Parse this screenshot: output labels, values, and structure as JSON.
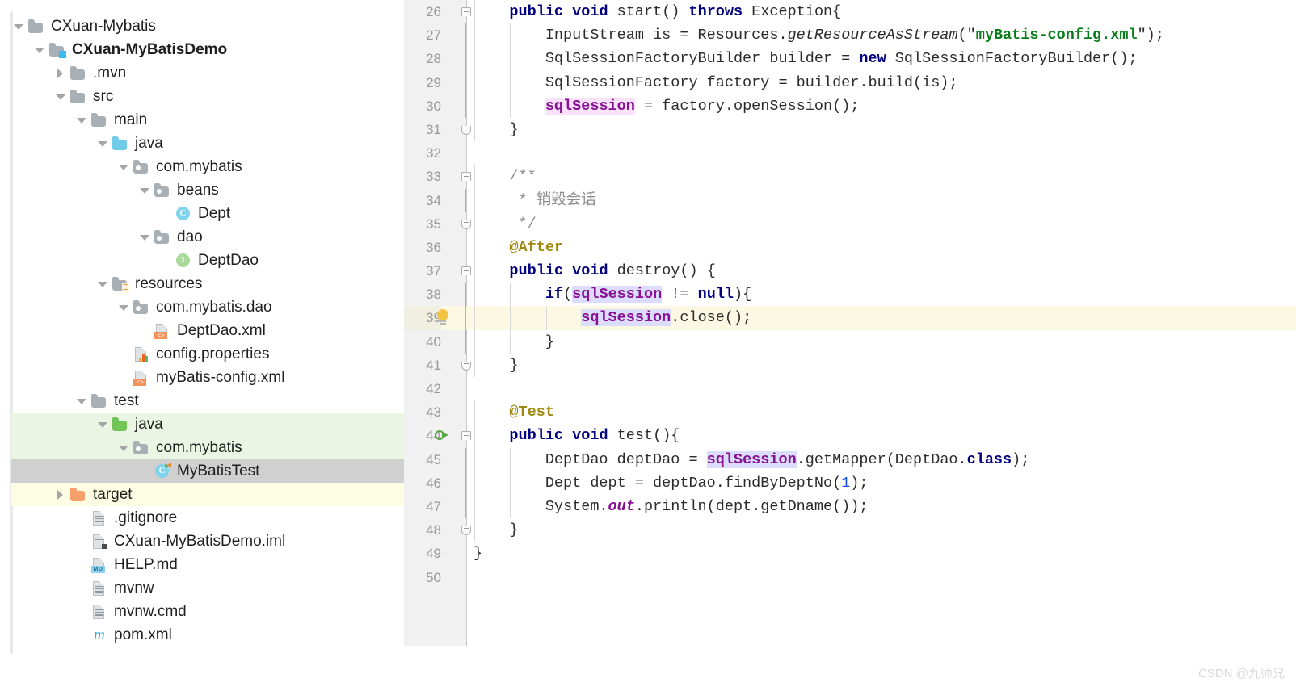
{
  "project_tree": {
    "scrollbar": "vertical-scrollbar",
    "items": [
      {
        "label": "CXuan-Mybatis",
        "depth": 0,
        "twisty": "down",
        "icon": "folder",
        "bold": false,
        "highlight": "none"
      },
      {
        "label": "CXuan-MyBatisDemo",
        "depth": 1,
        "twisty": "down",
        "icon": "folder-module",
        "bold": true,
        "highlight": "none"
      },
      {
        "label": ".mvn",
        "depth": 2,
        "twisty": "right",
        "icon": "folder",
        "bold": false,
        "highlight": "none"
      },
      {
        "label": "src",
        "depth": 2,
        "twisty": "down",
        "icon": "folder",
        "bold": false,
        "highlight": "none"
      },
      {
        "label": "main",
        "depth": 3,
        "twisty": "down",
        "icon": "folder",
        "bold": false,
        "highlight": "none"
      },
      {
        "label": "java",
        "depth": 4,
        "twisty": "down",
        "icon": "folder-blue",
        "bold": false,
        "highlight": "none"
      },
      {
        "label": "com.mybatis",
        "depth": 5,
        "twisty": "down",
        "icon": "pkg",
        "bold": false,
        "highlight": "none"
      },
      {
        "label": "beans",
        "depth": 6,
        "twisty": "down",
        "icon": "pkg",
        "bold": false,
        "highlight": "none"
      },
      {
        "label": "Dept",
        "depth": 7,
        "twisty": "none",
        "icon": "class",
        "bold": false,
        "highlight": "none"
      },
      {
        "label": "dao",
        "depth": 6,
        "twisty": "down",
        "icon": "pkg",
        "bold": false,
        "highlight": "none"
      },
      {
        "label": "DeptDao",
        "depth": 7,
        "twisty": "none",
        "icon": "interface",
        "bold": false,
        "highlight": "none"
      },
      {
        "label": "resources",
        "depth": 4,
        "twisty": "down",
        "icon": "folder-res",
        "bold": false,
        "highlight": "none"
      },
      {
        "label": "com.mybatis.dao",
        "depth": 5,
        "twisty": "down",
        "icon": "pkg",
        "bold": false,
        "highlight": "none"
      },
      {
        "label": "DeptDao.xml",
        "depth": 6,
        "twisty": "none",
        "icon": "xml",
        "bold": false,
        "highlight": "none"
      },
      {
        "label": "config.properties",
        "depth": 5,
        "twisty": "none",
        "icon": "properties",
        "bold": false,
        "highlight": "none"
      },
      {
        "label": "myBatis-config.xml",
        "depth": 5,
        "twisty": "none",
        "icon": "xml",
        "bold": false,
        "highlight": "none"
      },
      {
        "label": "test",
        "depth": 3,
        "twisty": "down",
        "icon": "folder",
        "bold": false,
        "highlight": "none"
      },
      {
        "label": "java",
        "depth": 4,
        "twisty": "down",
        "icon": "folder-green",
        "bold": false,
        "highlight": "green"
      },
      {
        "label": "com.mybatis",
        "depth": 5,
        "twisty": "down",
        "icon": "pkg",
        "bold": false,
        "highlight": "green"
      },
      {
        "label": "MyBatisTest",
        "depth": 6,
        "twisty": "none",
        "icon": "test-class",
        "bold": false,
        "highlight": "gray"
      },
      {
        "label": "target",
        "depth": 2,
        "twisty": "right",
        "icon": "folder-orange",
        "bold": false,
        "highlight": "yellow"
      },
      {
        "label": ".gitignore",
        "depth": 3,
        "twisty": "none",
        "icon": "file",
        "bold": false,
        "highlight": "none"
      },
      {
        "label": "CXuan-MyBatisDemo.iml",
        "depth": 3,
        "twisty": "none",
        "icon": "iml",
        "bold": false,
        "highlight": "none"
      },
      {
        "label": "HELP.md",
        "depth": 3,
        "twisty": "none",
        "icon": "md",
        "bold": false,
        "highlight": "none"
      },
      {
        "label": "mvnw",
        "depth": 3,
        "twisty": "none",
        "icon": "file",
        "bold": false,
        "highlight": "none"
      },
      {
        "label": "mvnw.cmd",
        "depth": 3,
        "twisty": "none",
        "icon": "file",
        "bold": false,
        "highlight": "none"
      },
      {
        "label": "pom.xml",
        "depth": 3,
        "twisty": "none",
        "icon": "maven",
        "bold": false,
        "highlight": "none"
      }
    ]
  },
  "editor": {
    "first_line_number": 26,
    "last_line_number": 50,
    "highlighted_line": 39,
    "bulb_line": 39,
    "run_arrow_line": 44,
    "lines": [
      {
        "n": 26,
        "fold": "open",
        "text": "    public void start() throws Exception{"
      },
      {
        "n": 27,
        "fold": "mid",
        "text": "        InputStream is = Resources.getResourceAsStream(\"myBatis-config.xml\");"
      },
      {
        "n": 28,
        "fold": "mid",
        "text": "        SqlSessionFactoryBuilder builder = new SqlSessionFactoryBuilder();"
      },
      {
        "n": 29,
        "fold": "mid",
        "text": "        SqlSessionFactory factory = builder.build(is);"
      },
      {
        "n": 30,
        "fold": "mid",
        "text": "        sqlSession = factory.openSession();"
      },
      {
        "n": 31,
        "fold": "close",
        "text": "    }"
      },
      {
        "n": 32,
        "fold": "none",
        "text": ""
      },
      {
        "n": 33,
        "fold": "open",
        "text": "    /**"
      },
      {
        "n": 34,
        "fold": "mid",
        "text": "     * 销毁会话"
      },
      {
        "n": 35,
        "fold": "close",
        "text": "     */"
      },
      {
        "n": 36,
        "fold": "none",
        "text": "    @After"
      },
      {
        "n": 37,
        "fold": "open",
        "text": "    public void destroy() {"
      },
      {
        "n": 38,
        "fold": "mid",
        "text": "        if(sqlSession != null){"
      },
      {
        "n": 39,
        "fold": "mid",
        "text": "            sqlSession.close();"
      },
      {
        "n": 40,
        "fold": "mid",
        "text": "        }"
      },
      {
        "n": 41,
        "fold": "close",
        "text": "    }"
      },
      {
        "n": 42,
        "fold": "none",
        "text": ""
      },
      {
        "n": 43,
        "fold": "none",
        "text": "    @Test"
      },
      {
        "n": 44,
        "fold": "open",
        "text": "    public void test(){"
      },
      {
        "n": 45,
        "fold": "mid",
        "text": "        DeptDao deptDao = sqlSession.getMapper(DeptDao.class);"
      },
      {
        "n": 46,
        "fold": "mid",
        "text": "        Dept dept = deptDao.findByDeptNo(1);"
      },
      {
        "n": 47,
        "fold": "mid",
        "text": "        System.out.println(dept.getDname());"
      },
      {
        "n": 48,
        "fold": "close",
        "text": "    }"
      },
      {
        "n": 49,
        "fold": "none",
        "text": "}"
      },
      {
        "n": 50,
        "fold": "none",
        "text": ""
      }
    ]
  },
  "watermark": {
    "text": "CSDN @九师兄"
  },
  "colors": {
    "keyword": "#000080",
    "string": "#067d17",
    "number": "#1750eb",
    "comment": "#8c8c8c",
    "annotation": "#9e880d",
    "field": "#871094",
    "gutter_bg": "#f1f1f1",
    "line_highlight": "#fdf8e3",
    "selection_pink": "#fae3fa",
    "selection_lavender": "#dcdcfc",
    "tree_green_row": "#eaf5e4",
    "tree_gray_row": "#d0d0d0",
    "tree_yellow_row": "#fdfde4"
  }
}
